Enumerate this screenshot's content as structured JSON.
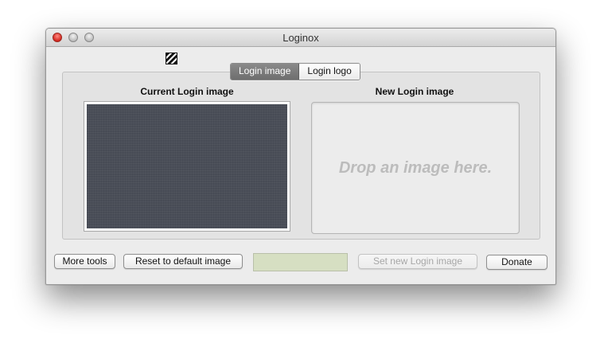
{
  "window": {
    "title": "Loginox"
  },
  "tabs": [
    {
      "label": "Login image",
      "active": true
    },
    {
      "label": "Login logo",
      "active": false
    }
  ],
  "panel": {
    "current_label": "Current Login image",
    "new_label": "New Login image",
    "drop_hint": "Drop an image here."
  },
  "buttons": {
    "more_tools": "More tools",
    "reset": "Reset to default image",
    "set_new": "Set new Login image",
    "donate": "Donate"
  },
  "colors": {
    "color_well": "#d6dfc2",
    "current_image_bg": "#4a4e58"
  }
}
